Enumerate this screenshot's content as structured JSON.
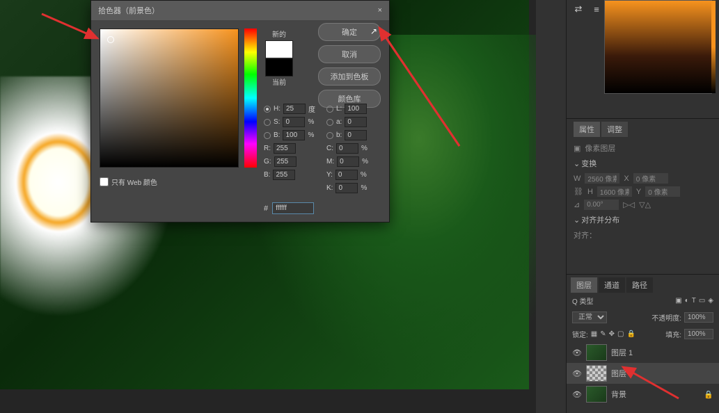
{
  "dialog": {
    "title": "拾色器（前景色）",
    "close": "×",
    "new_label": "新的",
    "current_label": "当前",
    "btn_ok": "确定",
    "btn_cancel": "取消",
    "btn_add": "添加到色板",
    "btn_lib": "颜色库",
    "web_only": "只有 Web 颜色",
    "fields": {
      "H": {
        "label": "H:",
        "value": "25",
        "unit": "度"
      },
      "S": {
        "label": "S:",
        "value": "0",
        "unit": "%"
      },
      "Bv": {
        "label": "B:",
        "value": "100",
        "unit": "%"
      },
      "R": {
        "label": "R:",
        "value": "255"
      },
      "G": {
        "label": "G:",
        "value": "255"
      },
      "B": {
        "label": "B:",
        "value": "255"
      },
      "L": {
        "label": "L:",
        "value": "100"
      },
      "a": {
        "label": "a:",
        "value": "0"
      },
      "b": {
        "label": "b:",
        "value": "0"
      },
      "C": {
        "label": "C:",
        "value": "0",
        "unit": "%"
      },
      "M": {
        "label": "M:",
        "value": "0",
        "unit": "%"
      },
      "Y": {
        "label": "Y:",
        "value": "0",
        "unit": "%"
      },
      "K": {
        "label": "K:",
        "value": "0",
        "unit": "%"
      }
    },
    "hex_label": "#",
    "hex_value": "ffffff"
  },
  "right": {
    "prop_tabs": [
      "属性",
      "调整"
    ],
    "pixel_layer": "像素图层",
    "transform": "变换",
    "W_label": "W",
    "W_value": "2560 像素",
    "H_label": "H",
    "H_value": "1600 像素",
    "X_label": "X",
    "X_value": "0 像素",
    "Y_label": "Y",
    "Y_value": "0 像素",
    "angle": "0.00°",
    "align": "对齐并分布",
    "align_sub": "对齐：",
    "layer_tabs": [
      "图层",
      "通道",
      "路径"
    ],
    "kind": "Q 类型",
    "blend": "正常",
    "opacity_label": "不透明度:",
    "opacity_value": "100%",
    "lock_label": "锁定:",
    "fill_label": "填充:",
    "fill_value": "100%",
    "layers": [
      {
        "name": "图层 1"
      },
      {
        "name": "图层 2"
      },
      {
        "name": "背景"
      }
    ]
  }
}
